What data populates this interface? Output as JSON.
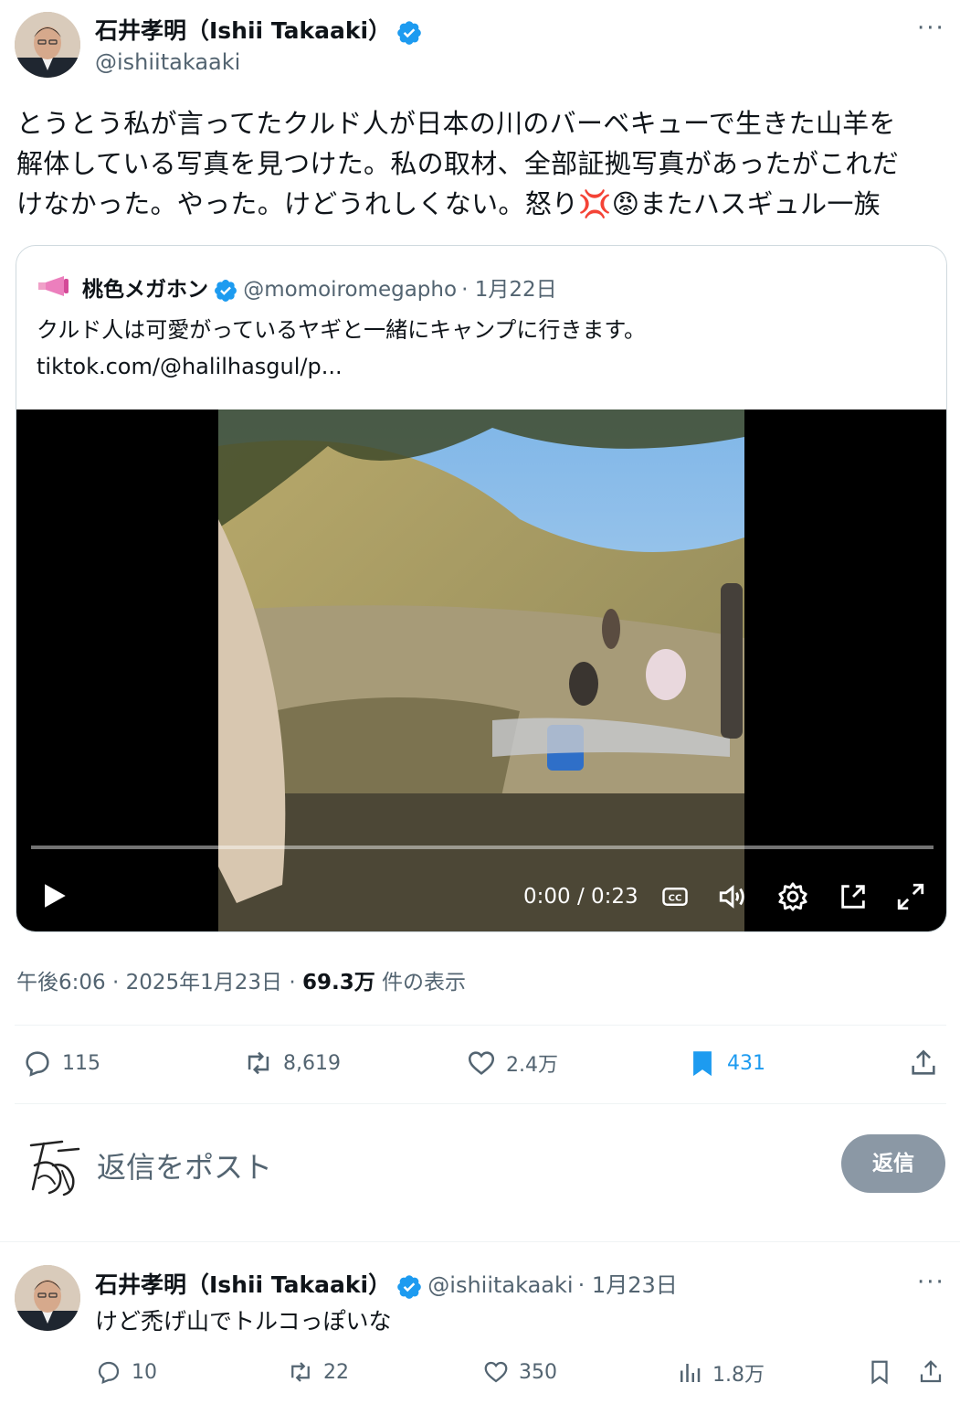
{
  "main_tweet": {
    "author_name": "石井孝明（Ishii Takaaki）",
    "author_handle": "@ishiitakaaki",
    "more_label": "···",
    "text_line1": "とうとう私が言ってたクルド人が日本の川のバーベキューで生きた山羊を",
    "text_line2": "解体している写真を見つけた。私の取材、全部証拠写真があったがこれだ",
    "text_line3": "けなかった。やった。けどうれしくない。怒り",
    "text_line3_end": "またハスギュル一族",
    "emoji_anger": "💢",
    "emoji_face": "😡"
  },
  "quoted_tweet": {
    "author_name": "桃色メガホン",
    "author_handle": "@momoiromegapho",
    "date": "· 1月22日",
    "text": "クルド人は可愛がっているヤギと一緒にキャンプに行きます。",
    "link": "tiktok.com/@halilhasgul/p..."
  },
  "video": {
    "time": "0:00 / 0:23",
    "progress": 0
  },
  "meta": {
    "time_date": "午後6:06 · 2025年1月23日 · ",
    "views": "69.3万",
    "views_label": " 件の表示"
  },
  "actions": {
    "replies": "115",
    "retweets": "8,619",
    "likes": "2.4万",
    "bookmarks": "431"
  },
  "reply_box": {
    "placeholder": "返信をポスト",
    "button": "返信"
  },
  "reply_tweet": {
    "author_name": "石井孝明（Ishii Takaaki）",
    "author_handle": "@ishiitakaaki",
    "date": "· 1月23日",
    "more_label": "···",
    "text": "けど禿げ山でトルコっぽいな",
    "replies": "10",
    "retweets": "22",
    "likes": "350",
    "views": "1.8万"
  },
  "colors": {
    "accent": "#1d9bf0",
    "muted": "#536471",
    "text": "#0f1419"
  }
}
